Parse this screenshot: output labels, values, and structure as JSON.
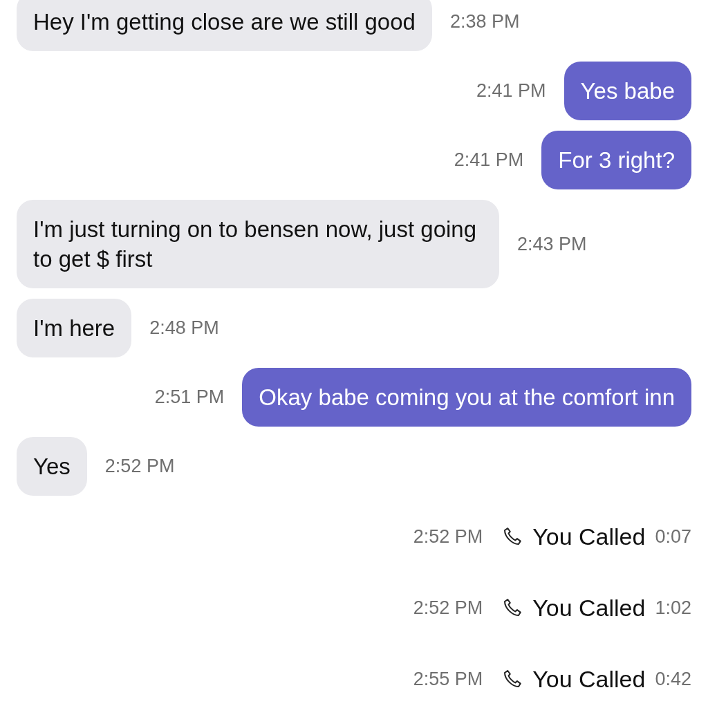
{
  "messages": [
    {
      "kind": "incoming",
      "text": "Hey I'm getting close are we still good",
      "time": "2:38 PM"
    },
    {
      "kind": "outgoing",
      "text": "Yes babe",
      "time": "2:41 PM"
    },
    {
      "kind": "outgoing",
      "text": "For 3 right?",
      "time": "2:41 PM"
    },
    {
      "kind": "incoming",
      "text": "I'm just turning on to bensen now, just going to get $ first",
      "time": "2:43 PM"
    },
    {
      "kind": "incoming",
      "text": "I'm here",
      "time": "2:48 PM"
    },
    {
      "kind": "outgoing",
      "text": "Okay babe coming you at the comfort inn",
      "time": "2:51 PM"
    },
    {
      "kind": "incoming",
      "text": "Yes",
      "time": "2:52 PM"
    },
    {
      "kind": "call",
      "text": "You Called",
      "duration": "0:07",
      "time": "2:52 PM"
    },
    {
      "kind": "call",
      "text": "You Called",
      "duration": "1:02",
      "time": "2:52 PM"
    },
    {
      "kind": "call",
      "text": "You Called",
      "duration": "0:42",
      "time": "2:55 PM"
    }
  ]
}
